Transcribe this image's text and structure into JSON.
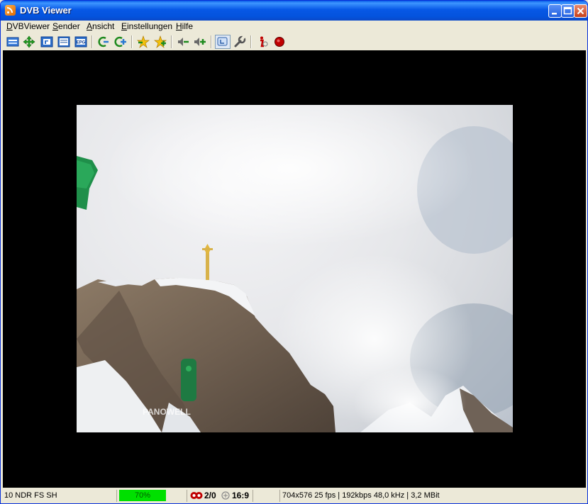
{
  "window": {
    "title": "DVB Viewer"
  },
  "menu": [
    {
      "label": "DVBViewer",
      "key": "D"
    },
    {
      "label": "Sender",
      "key": "S"
    },
    {
      "label": "Ansicht",
      "key": "A"
    },
    {
      "label": "Einstellungen",
      "key": "E"
    },
    {
      "label": "Hilfe",
      "key": "H"
    }
  ],
  "toolbar": {
    "icons": [
      "channel-list-icon",
      "move-icon",
      "teletext-icon",
      "osd-icon",
      "epg-icon",
      "previous-channel-icon",
      "next-channel-icon",
      "favorite-prev-icon",
      "favorite-next-icon",
      "volume-down-icon",
      "volume-up-icon",
      "display-mode-icon",
      "settings-wrench-icon",
      "info-icon",
      "record-icon"
    ],
    "epg_label": "EPG",
    "teletext_label": "TT"
  },
  "video": {
    "overlay_text": "PANOWELL"
  },
  "status": {
    "channel": "10 NDR FS SH",
    "signal": "70%",
    "signal_fraction": 0.7,
    "audio": "2/0",
    "aspect": "16:9",
    "stream_info": "704x576 25 fps | 192kbps 48,0 kHz | 3,2 MBit"
  },
  "colors": {
    "titlebar": "#0758e6",
    "signal": "#00e000",
    "chrome": "#ece9d8"
  }
}
